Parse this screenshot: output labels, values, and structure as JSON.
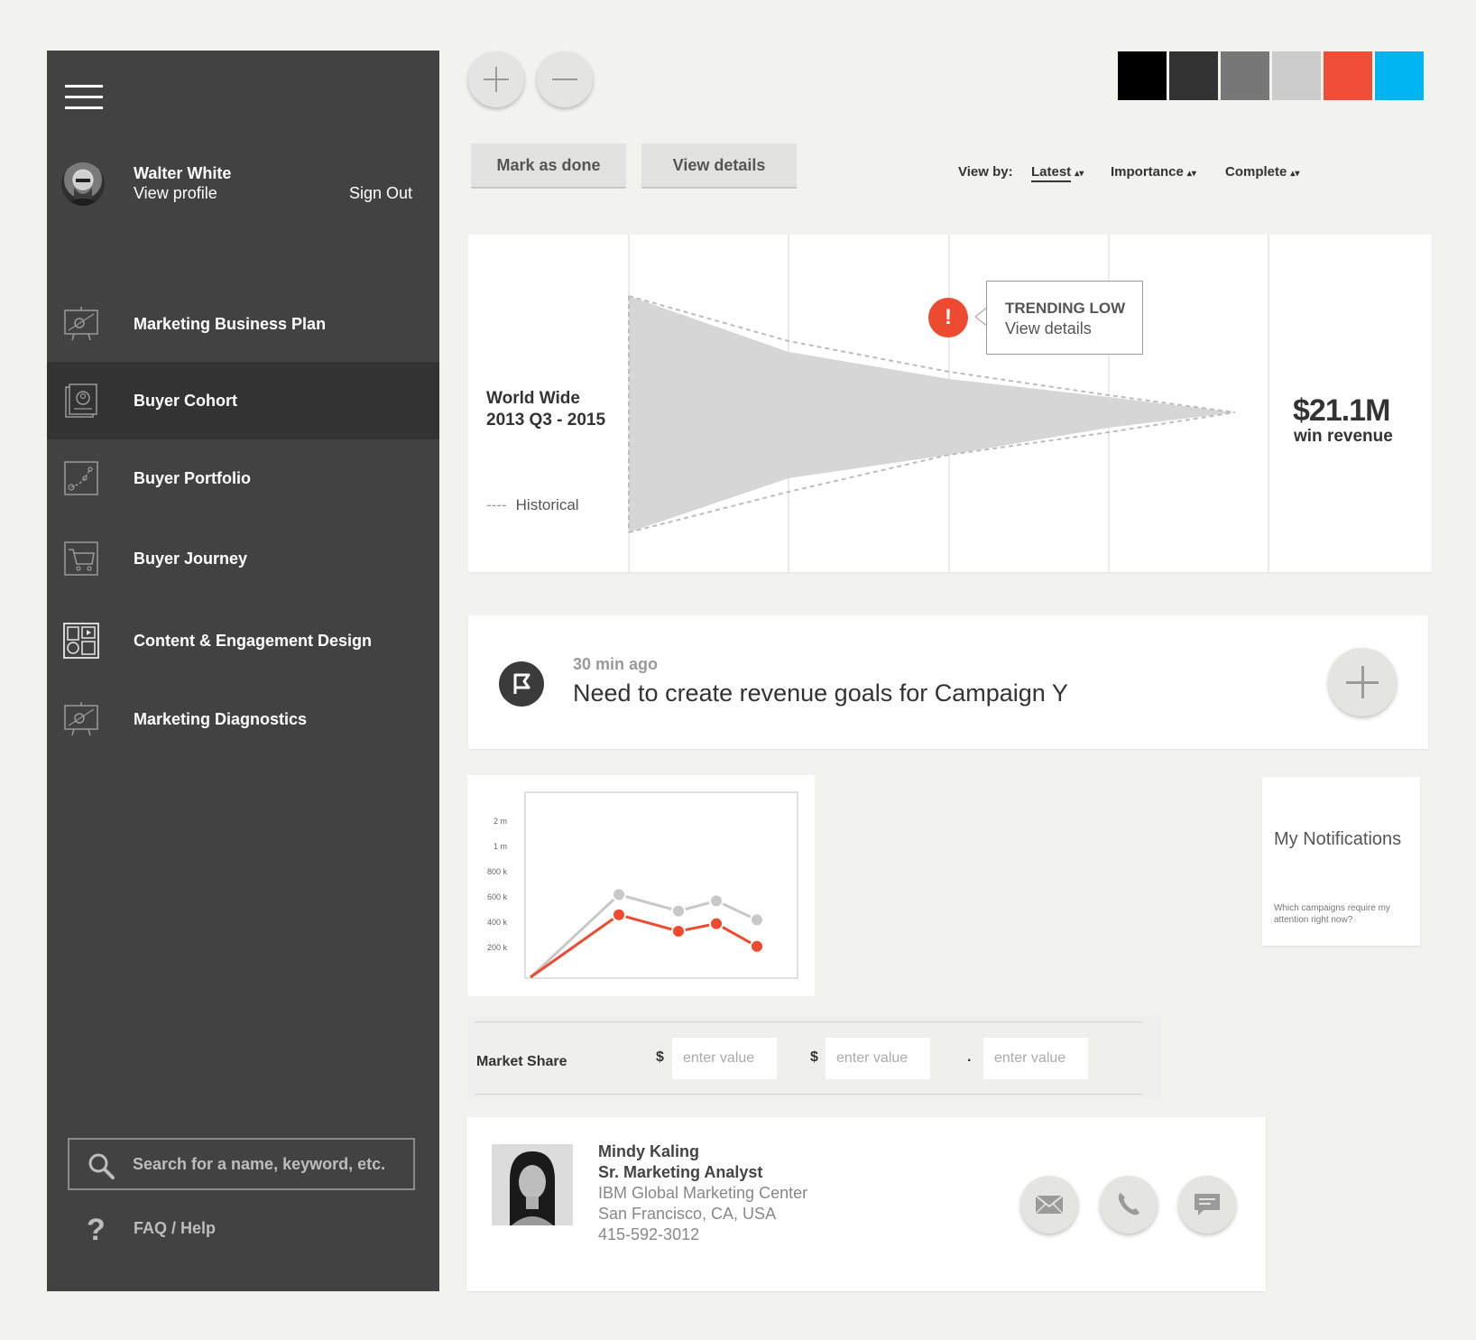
{
  "sidebar": {
    "user": {
      "name": "Walter White",
      "profile_link": "View profile",
      "sign_out": "Sign Out"
    },
    "items": [
      {
        "label": "Marketing Business Plan",
        "icon": "presentation-icon"
      },
      {
        "label": "Buyer Cohort",
        "icon": "profile-document-icon",
        "active": true
      },
      {
        "label": "Buyer Portfolio",
        "icon": "trend-chart-icon"
      },
      {
        "label": "Buyer Journey",
        "icon": "shopping-cart-icon"
      },
      {
        "label": "Content & Engagement Design",
        "icon": "layout-blocks-icon"
      },
      {
        "label": "Marketing Diagnostics",
        "icon": "presentation-diagnostics-icon"
      }
    ],
    "search": {
      "placeholder": "Search for a name, keyword, etc."
    },
    "help": {
      "label": "FAQ / Help",
      "icon_glyph": "?"
    }
  },
  "toolbar": {
    "zoom_in": "zoom-in-icon",
    "zoom_out": "zoom-out-icon",
    "swatches": [
      "#000000",
      "#333333",
      "#777777",
      "#cccccc",
      "#f04e37",
      "#00b4f0"
    ],
    "mark_done": "Mark as done",
    "view_details": "View details",
    "view_by_label": "View by:",
    "sorts": [
      {
        "label": "Latest",
        "active": true
      },
      {
        "label": "Importance"
      },
      {
        "label": "Complete"
      }
    ]
  },
  "funnel": {
    "region_line1": "World Wide",
    "region_line2": "2013 Q3 - 2015",
    "legend_dash": "----",
    "legend_label": "Historical",
    "alert_glyph": "!",
    "trend_title": "TRENDING LOW",
    "trend_link": "View details",
    "revenue_value": "$21.1M",
    "revenue_label": "win revenue",
    "accent": "#ee4a30"
  },
  "task": {
    "time": "30 min ago",
    "text": "Need to create revenue goals for Campaign Y",
    "flag_icon": "flag-icon",
    "add_icon": "plus-icon"
  },
  "chart_data": {
    "type": "line",
    "y_ticks": [
      "2 m",
      "1 m",
      "800 k",
      "600 k",
      "400 k",
      "200 k"
    ],
    "series": [
      {
        "color": "#c8c8c8",
        "values": [
          0,
          640000,
          510000,
          590000,
          440000
        ]
      },
      {
        "color": "#ee4a30",
        "values": [
          0,
          480000,
          350000,
          410000,
          230000
        ]
      }
    ],
    "grid": false
  },
  "notifications": {
    "title": "My Notifications",
    "subtitle": "Which campaigns require my attention right now?"
  },
  "market_share": {
    "label": "Market Share",
    "symbols": [
      "$",
      "$",
      "."
    ],
    "placeholders": [
      "enter value",
      "enter value",
      "enter value"
    ]
  },
  "contact": {
    "name": "Mindy Kaling",
    "title": "Sr. Marketing Analyst",
    "org": "IBM Global Marketing Center",
    "location": "San Francisco, CA, USA",
    "phone": "415-592-3012",
    "actions": [
      "mail-icon",
      "phone-icon",
      "chat-icon"
    ]
  }
}
